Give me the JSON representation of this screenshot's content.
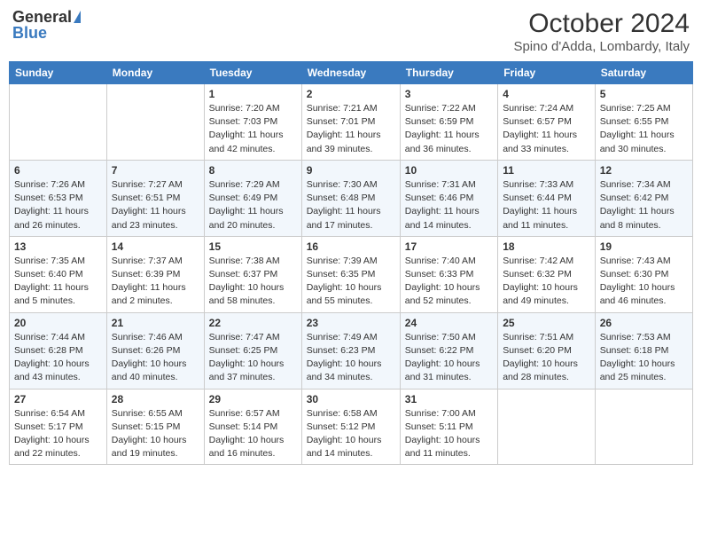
{
  "header": {
    "logo_general": "General",
    "logo_blue": "Blue",
    "month_year": "October 2024",
    "location": "Spino d'Adda, Lombardy, Italy"
  },
  "days_of_week": [
    "Sunday",
    "Monday",
    "Tuesday",
    "Wednesday",
    "Thursday",
    "Friday",
    "Saturday"
  ],
  "weeks": [
    [
      {
        "day": "",
        "sunrise": "",
        "sunset": "",
        "daylight": ""
      },
      {
        "day": "",
        "sunrise": "",
        "sunset": "",
        "daylight": ""
      },
      {
        "day": "1",
        "sunrise": "Sunrise: 7:20 AM",
        "sunset": "Sunset: 7:03 PM",
        "daylight": "Daylight: 11 hours and 42 minutes."
      },
      {
        "day": "2",
        "sunrise": "Sunrise: 7:21 AM",
        "sunset": "Sunset: 7:01 PM",
        "daylight": "Daylight: 11 hours and 39 minutes."
      },
      {
        "day": "3",
        "sunrise": "Sunrise: 7:22 AM",
        "sunset": "Sunset: 6:59 PM",
        "daylight": "Daylight: 11 hours and 36 minutes."
      },
      {
        "day": "4",
        "sunrise": "Sunrise: 7:24 AM",
        "sunset": "Sunset: 6:57 PM",
        "daylight": "Daylight: 11 hours and 33 minutes."
      },
      {
        "day": "5",
        "sunrise": "Sunrise: 7:25 AM",
        "sunset": "Sunset: 6:55 PM",
        "daylight": "Daylight: 11 hours and 30 minutes."
      }
    ],
    [
      {
        "day": "6",
        "sunrise": "Sunrise: 7:26 AM",
        "sunset": "Sunset: 6:53 PM",
        "daylight": "Daylight: 11 hours and 26 minutes."
      },
      {
        "day": "7",
        "sunrise": "Sunrise: 7:27 AM",
        "sunset": "Sunset: 6:51 PM",
        "daylight": "Daylight: 11 hours and 23 minutes."
      },
      {
        "day": "8",
        "sunrise": "Sunrise: 7:29 AM",
        "sunset": "Sunset: 6:49 PM",
        "daylight": "Daylight: 11 hours and 20 minutes."
      },
      {
        "day": "9",
        "sunrise": "Sunrise: 7:30 AM",
        "sunset": "Sunset: 6:48 PM",
        "daylight": "Daylight: 11 hours and 17 minutes."
      },
      {
        "day": "10",
        "sunrise": "Sunrise: 7:31 AM",
        "sunset": "Sunset: 6:46 PM",
        "daylight": "Daylight: 11 hours and 14 minutes."
      },
      {
        "day": "11",
        "sunrise": "Sunrise: 7:33 AM",
        "sunset": "Sunset: 6:44 PM",
        "daylight": "Daylight: 11 hours and 11 minutes."
      },
      {
        "day": "12",
        "sunrise": "Sunrise: 7:34 AM",
        "sunset": "Sunset: 6:42 PM",
        "daylight": "Daylight: 11 hours and 8 minutes."
      }
    ],
    [
      {
        "day": "13",
        "sunrise": "Sunrise: 7:35 AM",
        "sunset": "Sunset: 6:40 PM",
        "daylight": "Daylight: 11 hours and 5 minutes."
      },
      {
        "day": "14",
        "sunrise": "Sunrise: 7:37 AM",
        "sunset": "Sunset: 6:39 PM",
        "daylight": "Daylight: 11 hours and 2 minutes."
      },
      {
        "day": "15",
        "sunrise": "Sunrise: 7:38 AM",
        "sunset": "Sunset: 6:37 PM",
        "daylight": "Daylight: 10 hours and 58 minutes."
      },
      {
        "day": "16",
        "sunrise": "Sunrise: 7:39 AM",
        "sunset": "Sunset: 6:35 PM",
        "daylight": "Daylight: 10 hours and 55 minutes."
      },
      {
        "day": "17",
        "sunrise": "Sunrise: 7:40 AM",
        "sunset": "Sunset: 6:33 PM",
        "daylight": "Daylight: 10 hours and 52 minutes."
      },
      {
        "day": "18",
        "sunrise": "Sunrise: 7:42 AM",
        "sunset": "Sunset: 6:32 PM",
        "daylight": "Daylight: 10 hours and 49 minutes."
      },
      {
        "day": "19",
        "sunrise": "Sunrise: 7:43 AM",
        "sunset": "Sunset: 6:30 PM",
        "daylight": "Daylight: 10 hours and 46 minutes."
      }
    ],
    [
      {
        "day": "20",
        "sunrise": "Sunrise: 7:44 AM",
        "sunset": "Sunset: 6:28 PM",
        "daylight": "Daylight: 10 hours and 43 minutes."
      },
      {
        "day": "21",
        "sunrise": "Sunrise: 7:46 AM",
        "sunset": "Sunset: 6:26 PM",
        "daylight": "Daylight: 10 hours and 40 minutes."
      },
      {
        "day": "22",
        "sunrise": "Sunrise: 7:47 AM",
        "sunset": "Sunset: 6:25 PM",
        "daylight": "Daylight: 10 hours and 37 minutes."
      },
      {
        "day": "23",
        "sunrise": "Sunrise: 7:49 AM",
        "sunset": "Sunset: 6:23 PM",
        "daylight": "Daylight: 10 hours and 34 minutes."
      },
      {
        "day": "24",
        "sunrise": "Sunrise: 7:50 AM",
        "sunset": "Sunset: 6:22 PM",
        "daylight": "Daylight: 10 hours and 31 minutes."
      },
      {
        "day": "25",
        "sunrise": "Sunrise: 7:51 AM",
        "sunset": "Sunset: 6:20 PM",
        "daylight": "Daylight: 10 hours and 28 minutes."
      },
      {
        "day": "26",
        "sunrise": "Sunrise: 7:53 AM",
        "sunset": "Sunset: 6:18 PM",
        "daylight": "Daylight: 10 hours and 25 minutes."
      }
    ],
    [
      {
        "day": "27",
        "sunrise": "Sunrise: 6:54 AM",
        "sunset": "Sunset: 5:17 PM",
        "daylight": "Daylight: 10 hours and 22 minutes."
      },
      {
        "day": "28",
        "sunrise": "Sunrise: 6:55 AM",
        "sunset": "Sunset: 5:15 PM",
        "daylight": "Daylight: 10 hours and 19 minutes."
      },
      {
        "day": "29",
        "sunrise": "Sunrise: 6:57 AM",
        "sunset": "Sunset: 5:14 PM",
        "daylight": "Daylight: 10 hours and 16 minutes."
      },
      {
        "day": "30",
        "sunrise": "Sunrise: 6:58 AM",
        "sunset": "Sunset: 5:12 PM",
        "daylight": "Daylight: 10 hours and 14 minutes."
      },
      {
        "day": "31",
        "sunrise": "Sunrise: 7:00 AM",
        "sunset": "Sunset: 5:11 PM",
        "daylight": "Daylight: 10 hours and 11 minutes."
      },
      {
        "day": "",
        "sunrise": "",
        "sunset": "",
        "daylight": ""
      },
      {
        "day": "",
        "sunrise": "",
        "sunset": "",
        "daylight": ""
      }
    ]
  ]
}
